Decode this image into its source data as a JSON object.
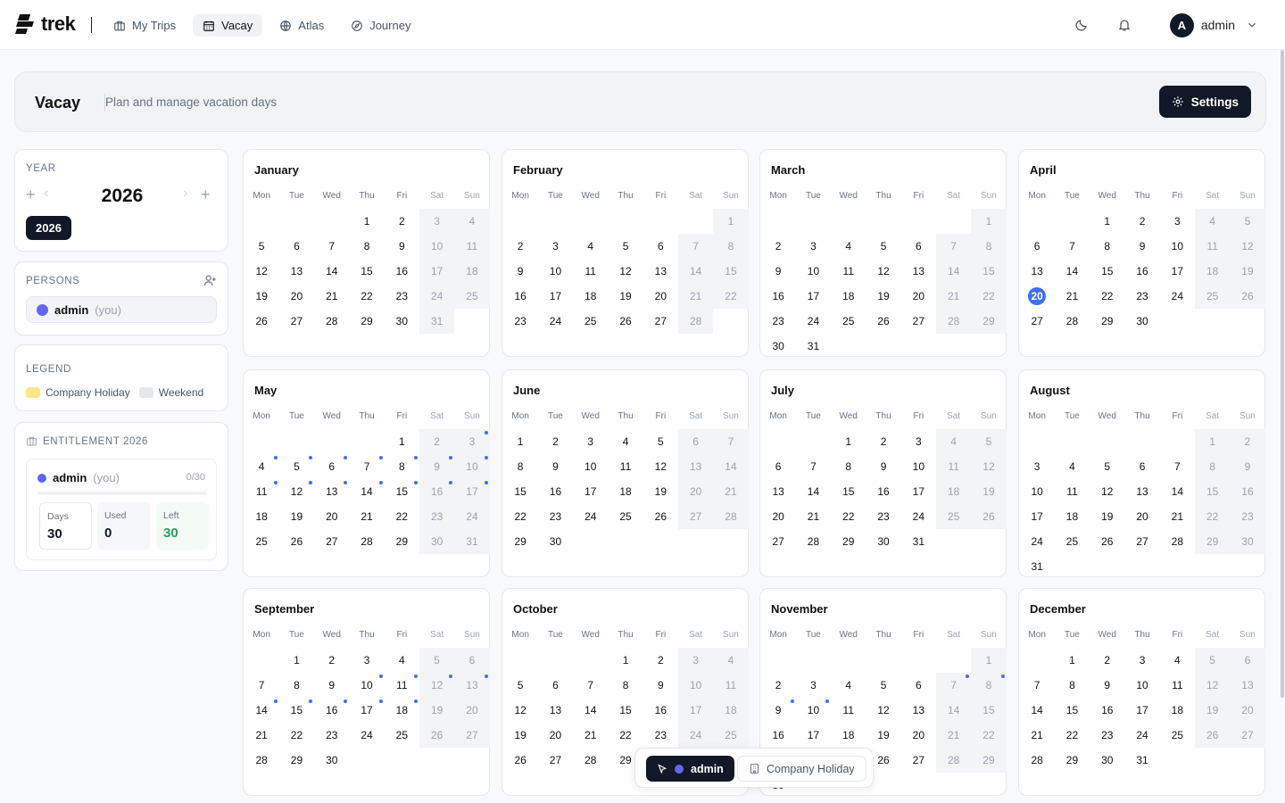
{
  "app": {
    "name": "trek"
  },
  "nav": {
    "items": [
      {
        "label": "My Trips",
        "icon": "briefcase-icon",
        "active": false
      },
      {
        "label": "Vacay",
        "icon": "calendar-icon",
        "active": true
      },
      {
        "label": "Atlas",
        "icon": "globe-icon",
        "active": false
      },
      {
        "label": "Journey",
        "icon": "compass-icon",
        "active": false
      }
    ],
    "user": {
      "initial": "A",
      "name": "admin"
    }
  },
  "header": {
    "title": "Vacay",
    "subtitle": "Plan and manage vacation days",
    "settings_label": "Settings"
  },
  "year_panel": {
    "label": "YEAR",
    "year": "2026",
    "selected_year": "2026"
  },
  "persons": {
    "label": "PERSONS",
    "items": [
      {
        "name": "admin",
        "suffix": "(you)",
        "color": "#6366f1"
      }
    ]
  },
  "legend": {
    "label": "LEGEND",
    "items": [
      {
        "label": "Company Holiday",
        "color": "#fde68a"
      },
      {
        "label": "Weekend",
        "color": "#e5e7eb"
      }
    ]
  },
  "entitlement": {
    "label": "ENTITLEMENT 2026",
    "name": "admin",
    "suffix": "(you)",
    "count": "0/30",
    "days_label": "Days",
    "days": "30",
    "used_label": "Used",
    "used": "0",
    "left_label": "Left",
    "left": "30"
  },
  "calendar": {
    "weekdays": [
      "Mon",
      "Tue",
      "Wed",
      "Thu",
      "Fri",
      "Sat",
      "Sun"
    ],
    "today": {
      "month": 3,
      "day": 20
    },
    "months": [
      {
        "name": "January",
        "offset": 3,
        "days": 31
      },
      {
        "name": "February",
        "offset": 6,
        "days": 28
      },
      {
        "name": "March",
        "offset": 6,
        "days": 31
      },
      {
        "name": "April",
        "offset": 2,
        "days": 30
      },
      {
        "name": "May",
        "offset": 4,
        "days": 31,
        "marked": [
          3,
          4,
          5,
          6,
          7,
          8,
          9,
          10,
          11,
          12,
          13,
          14,
          15,
          16,
          17
        ]
      },
      {
        "name": "June",
        "offset": 0,
        "days": 30
      },
      {
        "name": "July",
        "offset": 2,
        "days": 31
      },
      {
        "name": "August",
        "offset": 5,
        "days": 31
      },
      {
        "name": "September",
        "offset": 1,
        "days": 30,
        "marked": [
          10,
          11,
          12,
          13,
          14,
          15,
          16,
          17,
          18
        ]
      },
      {
        "name": "October",
        "offset": 3,
        "days": 31
      },
      {
        "name": "November",
        "offset": 6,
        "days": 30,
        "marked": [
          7,
          8,
          9,
          10
        ]
      },
      {
        "name": "December",
        "offset": 1,
        "days": 31
      }
    ]
  },
  "floatbar": {
    "person": "admin",
    "holiday_label": "Company Holiday"
  }
}
